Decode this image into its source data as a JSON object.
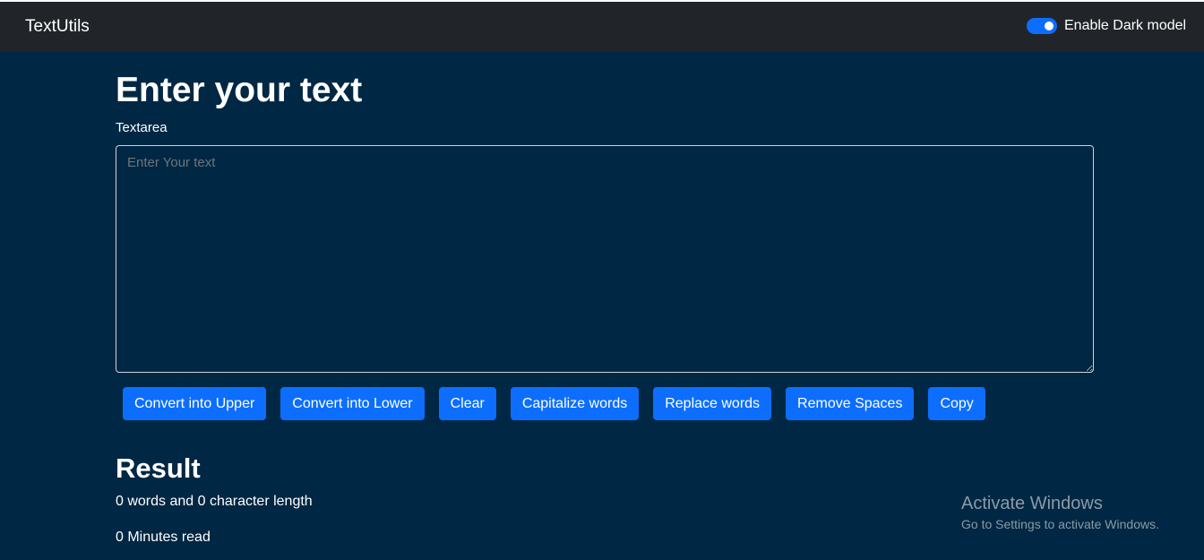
{
  "navbar": {
    "brand": "TextUtils",
    "dark_mode_label": "Enable Dark model",
    "dark_mode_enabled": true
  },
  "main": {
    "heading": "Enter your text",
    "textarea_label": "Textarea",
    "textarea_placeholder": "Enter Your text",
    "textarea_value": "",
    "buttons": [
      {
        "label": "Convert into Upper"
      },
      {
        "label": "Convert into Lower"
      },
      {
        "label": "Clear"
      },
      {
        "label": "Capitalize words"
      },
      {
        "label": "Replace words"
      },
      {
        "label": "Remove Spaces"
      },
      {
        "label": "Copy"
      }
    ]
  },
  "result": {
    "heading": "Result",
    "summary": "0 words and 0 character length",
    "read_time": "0 Minutes read"
  },
  "watermark": {
    "title": "Activate Windows",
    "subtitle": "Go to Settings to activate Windows."
  },
  "colors": {
    "background": "#002743",
    "navbar": "#212529",
    "accent": "#0d6efd"
  }
}
